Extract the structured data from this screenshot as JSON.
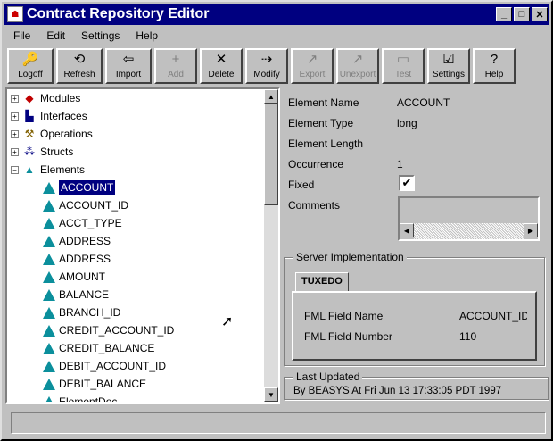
{
  "window": {
    "title": "Contract Repository Editor"
  },
  "menu": [
    "File",
    "Edit",
    "Settings",
    "Help"
  ],
  "toolbar": [
    {
      "label": "Logoff",
      "icon": "key-icon",
      "glyph": "🔑",
      "disabled": false
    },
    {
      "label": "Refresh",
      "icon": "refresh-icon",
      "glyph": "⟲",
      "disabled": false
    },
    {
      "label": "Import",
      "icon": "import-icon",
      "glyph": "⇦",
      "disabled": false
    },
    {
      "label": "Add",
      "icon": "add-icon",
      "glyph": "+",
      "disabled": true
    },
    {
      "label": "Delete",
      "icon": "delete-icon",
      "glyph": "✕",
      "disabled": false
    },
    {
      "label": "Modify",
      "icon": "modify-icon",
      "glyph": "⇢",
      "disabled": false
    },
    {
      "label": "Export",
      "icon": "export-icon",
      "glyph": "↗",
      "disabled": true
    },
    {
      "label": "Unexport",
      "icon": "unexport-icon",
      "glyph": "↗",
      "disabled": true
    },
    {
      "label": "Test",
      "icon": "test-icon",
      "glyph": "▭",
      "disabled": true
    },
    {
      "label": "Settings",
      "icon": "settings-icon",
      "glyph": "☑",
      "disabled": false
    },
    {
      "label": "Help",
      "icon": "help-icon",
      "glyph": "?",
      "disabled": false
    }
  ],
  "tree": {
    "categories": [
      {
        "label": "Modules",
        "expanded": false
      },
      {
        "label": "Interfaces",
        "expanded": false
      },
      {
        "label": "Operations",
        "expanded": false
      },
      {
        "label": "Structs",
        "expanded": false
      },
      {
        "label": "Elements",
        "expanded": true
      }
    ],
    "elements": [
      "ACCOUNT",
      "ACCOUNT_ID",
      "ACCT_TYPE",
      "ADDRESS",
      "ADDRESS",
      "AMOUNT",
      "BALANCE",
      "BRANCH_ID",
      "CREDIT_ACCOUNT_ID",
      "CREDIT_BALANCE",
      "DEBIT_ACCOUNT_ID",
      "DEBIT_BALANCE",
      "ElementDoc"
    ],
    "selected": "ACCOUNT"
  },
  "details": {
    "element_name_label": "Element Name",
    "element_name": "ACCOUNT",
    "element_type_label": "Element Type",
    "element_type": "long",
    "element_length_label": "Element Length",
    "occurrence_label": "Occurrence",
    "occurrence": "1",
    "fixed_label": "Fixed",
    "fixed_checked": "✔",
    "comments_label": "Comments"
  },
  "server": {
    "group_label": "Server Implementation",
    "tab": "TUXEDO",
    "fml_name_label": "FML Field Name",
    "fml_name": "ACCOUNT_ID",
    "fml_number_label": "FML Field Number",
    "fml_number": "110"
  },
  "last_updated": {
    "group_label": "Last Updated",
    "text": "By BEASYS At Fri Jun 13 17:33:05 PDT 1997"
  }
}
